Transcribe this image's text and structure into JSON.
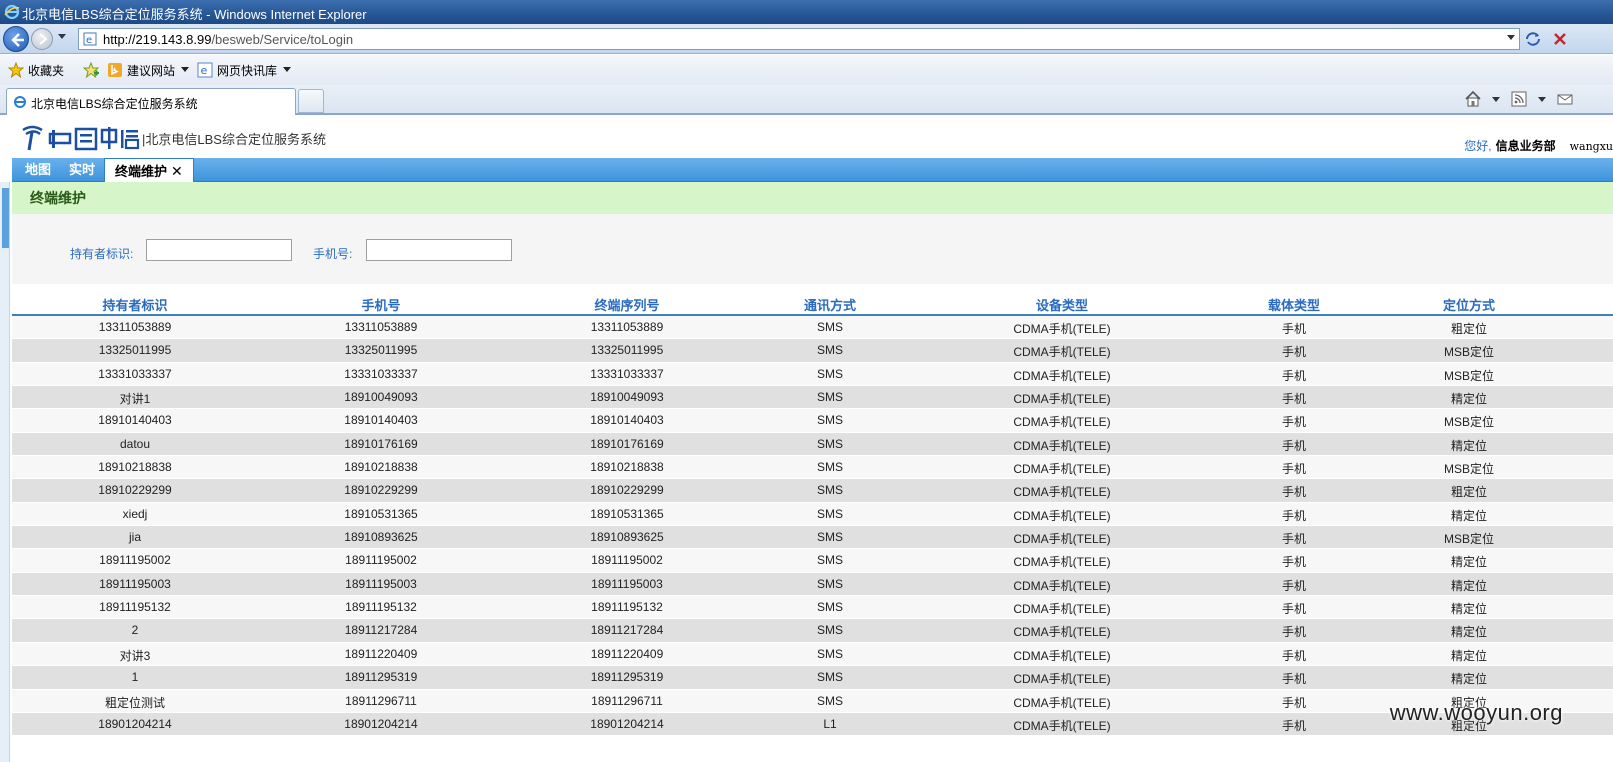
{
  "window": {
    "title": "北京电信LBS综合定位服务系统 - Windows Internet Explorer"
  },
  "address": {
    "url_host": "http://219.143.8.99",
    "url_path": "/besweb/Service/toLogin"
  },
  "favorites": {
    "favorites_label": "收藏夹",
    "suggested_label": "建议网站",
    "webslice_label": "网页快讯库"
  },
  "browser_tab": {
    "label": "北京电信LBS综合定位服务系统"
  },
  "app": {
    "system_title": "|北京电信LBS综合定位服务系统",
    "greeting": "您好,",
    "department": "信息业务部",
    "username": "wangxu",
    "tabs": [
      "地图",
      "实时",
      "终端维护"
    ],
    "close_glyph": "✕",
    "section_title": "终端维护"
  },
  "search": {
    "holder_label": "持有者标识:",
    "phone_label": "手机号:"
  },
  "table": {
    "headers": [
      "持有者标识",
      "手机号",
      "终端序列号",
      "通讯方式",
      "设备类型",
      "载体类型",
      "定位方式"
    ],
    "rows": [
      [
        "13311053889",
        "13311053889",
        "13311053889",
        "SMS",
        "CDMA手机(TELE)",
        "手机",
        "粗定位"
      ],
      [
        "13325011995",
        "13325011995",
        "13325011995",
        "SMS",
        "CDMA手机(TELE)",
        "手机",
        "MSB定位"
      ],
      [
        "13331033337",
        "13331033337",
        "13331033337",
        "SMS",
        "CDMA手机(TELE)",
        "手机",
        "MSB定位"
      ],
      [
        "对讲1",
        "18910049093",
        "18910049093",
        "SMS",
        "CDMA手机(TELE)",
        "手机",
        "精定位"
      ],
      [
        "18910140403",
        "18910140403",
        "18910140403",
        "SMS",
        "CDMA手机(TELE)",
        "手机",
        "MSB定位"
      ],
      [
        "datou",
        "18910176169",
        "18910176169",
        "SMS",
        "CDMA手机(TELE)",
        "手机",
        "精定位"
      ],
      [
        "18910218838",
        "18910218838",
        "18910218838",
        "SMS",
        "CDMA手机(TELE)",
        "手机",
        "MSB定位"
      ],
      [
        "18910229299",
        "18910229299",
        "18910229299",
        "SMS",
        "CDMA手机(TELE)",
        "手机",
        "粗定位"
      ],
      [
        "xiedj",
        "18910531365",
        "18910531365",
        "SMS",
        "CDMA手机(TELE)",
        "手机",
        "精定位"
      ],
      [
        "jia",
        "18910893625",
        "18910893625",
        "SMS",
        "CDMA手机(TELE)",
        "手机",
        "MSB定位"
      ],
      [
        "18911195002",
        "18911195002",
        "18911195002",
        "SMS",
        "CDMA手机(TELE)",
        "手机",
        "精定位"
      ],
      [
        "18911195003",
        "18911195003",
        "18911195003",
        "SMS",
        "CDMA手机(TELE)",
        "手机",
        "精定位"
      ],
      [
        "18911195132",
        "18911195132",
        "18911195132",
        "SMS",
        "CDMA手机(TELE)",
        "手机",
        "精定位"
      ],
      [
        "2",
        "18911217284",
        "18911217284",
        "SMS",
        "CDMA手机(TELE)",
        "手机",
        "精定位"
      ],
      [
        "对讲3",
        "18911220409",
        "18911220409",
        "SMS",
        "CDMA手机(TELE)",
        "手机",
        "精定位"
      ],
      [
        "1",
        "18911295319",
        "18911295319",
        "SMS",
        "CDMA手机(TELE)",
        "手机",
        "精定位"
      ],
      [
        "粗定位测试",
        "18911296711",
        "18911296711",
        "SMS",
        "CDMA手机(TELE)",
        "手机",
        "粗定位"
      ],
      [
        "18901204214",
        "18901204214",
        "18901204214",
        "L1",
        "CDMA手机(TELE)",
        "手机",
        "粗定位"
      ]
    ]
  },
  "watermark": "www.wooyun.org",
  "colors": {
    "header_accent": "#2a6bc0",
    "tab_bar": "#3e94dc",
    "section_bg": "#d6f5c8"
  }
}
